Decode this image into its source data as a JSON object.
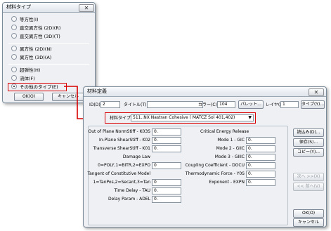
{
  "dialog1": {
    "title": "材料タイプ",
    "options": [
      "等方性(I)",
      "直交異方性 (2D)(R)",
      "直交異方性 (3D)(T)",
      "異方性 (2D)(N)",
      "異方性 (3D)(A)",
      "超弾性(H)",
      "流体(F)",
      "その他のタイプ(E)"
    ],
    "selected_index": 7,
    "ok_label": "OK(O)",
    "cancel_label": "キャンセル"
  },
  "dialog2": {
    "title": "材料定義",
    "id_label": "ID(D)",
    "id_value": "2",
    "title_field_label": "タイトル(T)",
    "title_value": "",
    "color_label": "カラー(C)",
    "color_value": "104",
    "palette_label": "パレット...",
    "layer_label": "レイヤ(L)",
    "layer_value": "1",
    "type_button_label": "タイプ(Y)...",
    "material_type_label": "材料タイプ",
    "material_type_value": "511..NX Nastran Cohesive ( MATCZ Sol 401,402)",
    "left_fields": [
      {
        "label": "Out of Plane NormStiff - K03S",
        "value": "0."
      },
      {
        "label": "In-Plane ShearStiff - K02",
        "value": "0."
      },
      {
        "label": "Transverse ShearStiff - K01",
        "value": "0."
      },
      {
        "label": "Damage Law",
        "value": ""
      },
      {
        "label": "0=POLY,1=BITR,2=EXPO",
        "value": "0"
      },
      {
        "label": "Tangent of Constitutive Model",
        "value": ""
      },
      {
        "label": "1=TanPos,2=Secant,3=Tan",
        "value": "0"
      },
      {
        "label": "Time Delay - TAU",
        "value": "0."
      },
      {
        "label": "Delay Param - ADEL",
        "value": "0."
      }
    ],
    "right_fields": [
      {
        "label": "Critical Energy Release",
        "value": ""
      },
      {
        "label": "Mode 1 - GIC",
        "value": "0."
      },
      {
        "label": "Mode 2 - GIIC",
        "value": "0."
      },
      {
        "label": "Mode 3 - GIIIC",
        "value": "0."
      },
      {
        "label": "Coupling Coefficient - DOCU",
        "value": "0."
      },
      {
        "label": "Thermodynamic Force - Y0S",
        "value": "0."
      },
      {
        "label": "Exponent - EXPN",
        "value": "0."
      }
    ],
    "side_buttons": [
      "読込み(D)...",
      "保存(S)...",
      "コピー(Y)..."
    ],
    "next_label": "次へ >>(X)",
    "prev_label": "<< 前へ(V)",
    "ok_label": "OK(O)",
    "cancel_label": "キャンセル"
  },
  "colors": {
    "highlight": "#d80000",
    "dialog_bg": "#eef0f3"
  }
}
